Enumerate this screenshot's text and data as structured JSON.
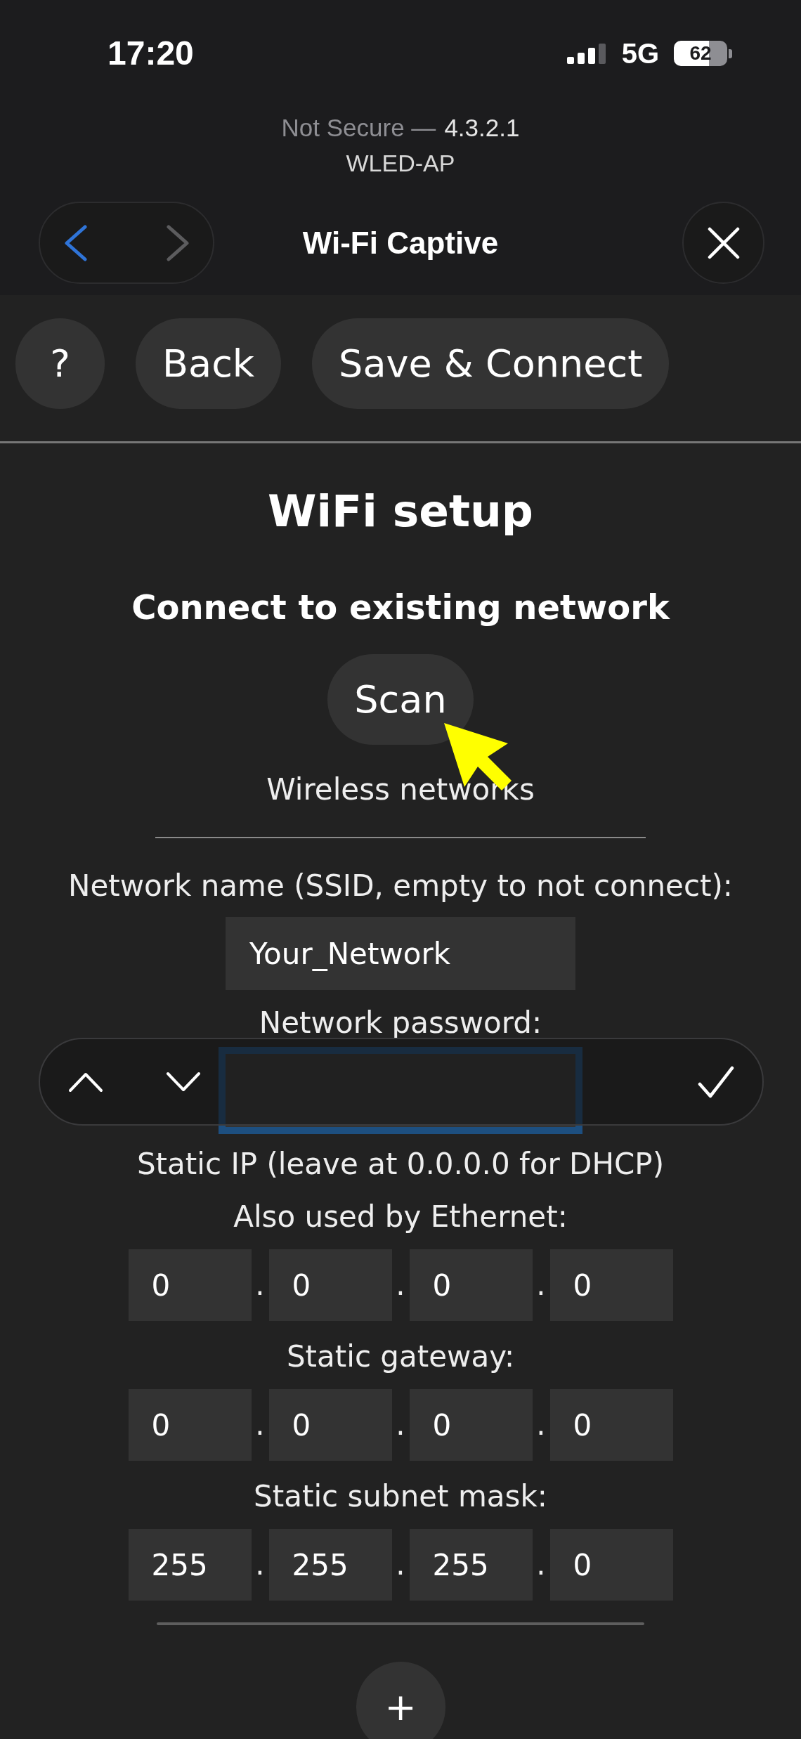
{
  "status_bar": {
    "time": "17:20",
    "network": "5G",
    "battery": "62"
  },
  "browser_bar": {
    "security": "Not Secure —",
    "address": "4.3.2.1",
    "site": "WLED-AP",
    "title": "Wi-Fi Captive",
    "nav_buttons": [
      {
        "kind": "back",
        "disabled": false
      },
      {
        "kind": "forward",
        "disabled": true
      }
    ]
  },
  "toolbar": {
    "buttons": [
      {
        "label": "?"
      },
      {
        "label": "Back"
      },
      {
        "label": "Save & Connect"
      }
    ]
  },
  "setup": {
    "title": "WiFi setup",
    "section_title": "Connect to existing network",
    "scan_button": "Scan",
    "networks_label": "Wireless networks",
    "fields": [
      {
        "kind": "text",
        "label": "Network name (SSID, empty to not connect):",
        "value": "Your_Network",
        "focused": false
      },
      {
        "kind": "password",
        "label": "Network password:",
        "focused": true
      }
    ],
    "static_ip_note": "Static IP (leave at 0.0.0.0 for DHCP)",
    "ip_groups": [
      {
        "label": "Also used by Ethernet:",
        "octets": [
          {
            "value": "0"
          },
          {
            "separator": ".",
            "value": "0"
          },
          {
            "separator": ".",
            "value": "0"
          },
          {
            "separator": ".",
            "value": "0"
          }
        ]
      },
      {
        "label": "Static gateway:",
        "octets": [
          {
            "value": "0"
          },
          {
            "separator": ".",
            "value": "0"
          },
          {
            "separator": ".",
            "value": "0"
          },
          {
            "separator": ".",
            "value": "0"
          }
        ]
      },
      {
        "label": "Static subnet mask:",
        "octets": [
          {
            "value": "255"
          },
          {
            "separator": ".",
            "value": "255"
          },
          {
            "separator": ".",
            "value": "255"
          },
          {
            "separator": ".",
            "value": "0"
          }
        ]
      }
    ],
    "add_button": "+"
  }
}
